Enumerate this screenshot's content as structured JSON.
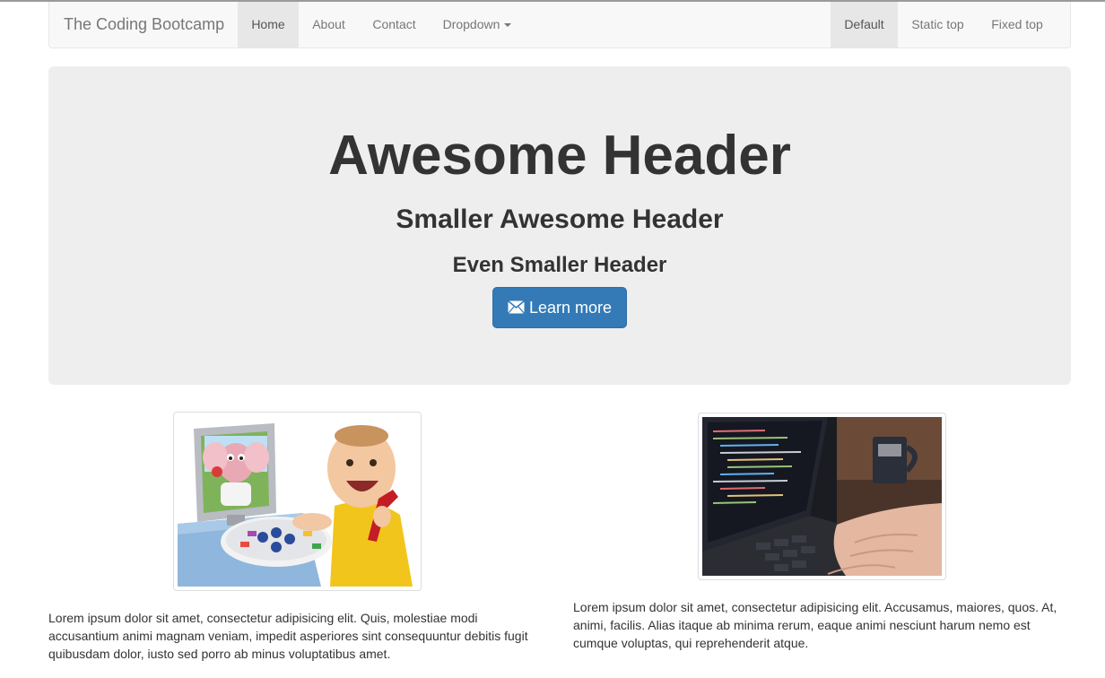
{
  "navbar": {
    "brand": "The Coding Bootcamp",
    "left_items": [
      {
        "label": "Home",
        "active": true
      },
      {
        "label": "About"
      },
      {
        "label": "Contact"
      },
      {
        "label": "Dropdown"
      }
    ],
    "right_items": [
      {
        "label": "Default",
        "active": true
      },
      {
        "label": "Static top"
      },
      {
        "label": "Fixed top"
      }
    ]
  },
  "jumbotron": {
    "heading": "Awesome Header",
    "subheading": "Smaller Awesome Header",
    "subsubheading": "Even Smaller Header",
    "button_label": "Learn more",
    "button_icon": "envelope-icon"
  },
  "thumbnails": [
    {
      "image": "cartoon elephant on computer screen with laughing toddler"
    },
    {
      "image": "hands typing on laptop with code on screen"
    }
  ],
  "paragraphs": [
    "Lorem ipsum dolor sit amet, consectetur adipisicing elit. Quis, molestiae modi accusantium animi magnam veniam, impedit asperiores sint consequuntur debitis fugit quibusdam dolor, iusto sed porro ab minus voluptatibus amet.",
    "Lorem ipsum dolor sit amet, consectetur adipisicing elit. Accusamus, maiores, quos. At, animi, facilis. Alias itaque ab minima rerum, eaque animi nesciunt harum nemo est cumque voluptas, qui reprehenderit atque."
  ],
  "colors": {
    "primary": "#337ab7",
    "jumbotron_bg": "#eeeeee",
    "navbar_bg": "#f8f8f8"
  }
}
